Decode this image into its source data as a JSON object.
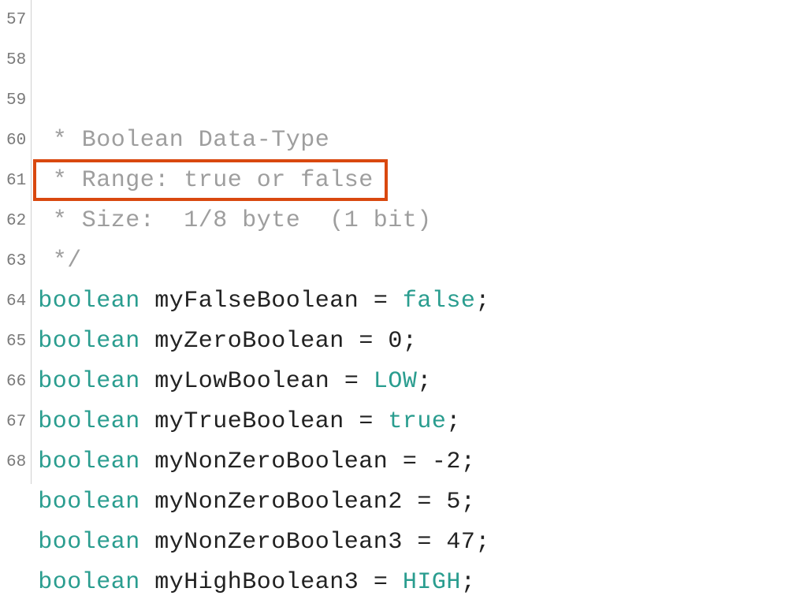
{
  "gutter_start": 57,
  "highlighted_line_index": 1,
  "lines": [
    {
      "tokens": [
        {
          "cls": "tok-comment",
          "text": " * Boolean Data-Type"
        }
      ]
    },
    {
      "tokens": [
        {
          "cls": "tok-comment",
          "text": " * Range: true or false"
        }
      ]
    },
    {
      "tokens": [
        {
          "cls": "tok-comment",
          "text": " * Size:  1/8 byte  (1 bit)"
        }
      ]
    },
    {
      "tokens": [
        {
          "cls": "tok-comment",
          "text": " */"
        }
      ]
    },
    {
      "tokens": [
        {
          "cls": "tok-keyword",
          "text": "boolean"
        },
        {
          "cls": "sp",
          "text": " "
        },
        {
          "cls": "tok-ident",
          "text": "myFalseBoolean"
        },
        {
          "cls": "sp",
          "text": " "
        },
        {
          "cls": "tok-op",
          "text": "="
        },
        {
          "cls": "sp",
          "text": " "
        },
        {
          "cls": "tok-literal",
          "text": "false"
        },
        {
          "cls": "tok-punc",
          "text": ";"
        }
      ]
    },
    {
      "tokens": [
        {
          "cls": "tok-keyword",
          "text": "boolean"
        },
        {
          "cls": "sp",
          "text": " "
        },
        {
          "cls": "tok-ident",
          "text": "myZeroBoolean"
        },
        {
          "cls": "sp",
          "text": " "
        },
        {
          "cls": "tok-op",
          "text": "="
        },
        {
          "cls": "sp",
          "text": " "
        },
        {
          "cls": "tok-number",
          "text": "0"
        },
        {
          "cls": "tok-punc",
          "text": ";"
        }
      ]
    },
    {
      "tokens": [
        {
          "cls": "tok-keyword",
          "text": "boolean"
        },
        {
          "cls": "sp",
          "text": " "
        },
        {
          "cls": "tok-ident",
          "text": "myLowBoolean"
        },
        {
          "cls": "sp",
          "text": " "
        },
        {
          "cls": "tok-op",
          "text": "="
        },
        {
          "cls": "sp",
          "text": " "
        },
        {
          "cls": "tok-const",
          "text": "LOW"
        },
        {
          "cls": "tok-punc",
          "text": ";"
        }
      ]
    },
    {
      "tokens": [
        {
          "cls": "tok-keyword",
          "text": "boolean"
        },
        {
          "cls": "sp",
          "text": " "
        },
        {
          "cls": "tok-ident",
          "text": "myTrueBoolean"
        },
        {
          "cls": "sp",
          "text": " "
        },
        {
          "cls": "tok-op",
          "text": "="
        },
        {
          "cls": "sp",
          "text": " "
        },
        {
          "cls": "tok-literal",
          "text": "true"
        },
        {
          "cls": "tok-punc",
          "text": ";"
        }
      ]
    },
    {
      "tokens": [
        {
          "cls": "tok-keyword",
          "text": "boolean"
        },
        {
          "cls": "sp",
          "text": " "
        },
        {
          "cls": "tok-ident",
          "text": "myNonZeroBoolean"
        },
        {
          "cls": "sp",
          "text": " "
        },
        {
          "cls": "tok-op",
          "text": "="
        },
        {
          "cls": "sp",
          "text": " "
        },
        {
          "cls": "tok-op",
          "text": "-"
        },
        {
          "cls": "tok-number",
          "text": "2"
        },
        {
          "cls": "tok-punc",
          "text": ";"
        }
      ]
    },
    {
      "tokens": [
        {
          "cls": "tok-keyword",
          "text": "boolean"
        },
        {
          "cls": "sp",
          "text": " "
        },
        {
          "cls": "tok-ident",
          "text": "myNonZeroBoolean2"
        },
        {
          "cls": "sp",
          "text": " "
        },
        {
          "cls": "tok-op",
          "text": "="
        },
        {
          "cls": "sp",
          "text": " "
        },
        {
          "cls": "tok-number",
          "text": "5"
        },
        {
          "cls": "tok-punc",
          "text": ";"
        }
      ]
    },
    {
      "tokens": [
        {
          "cls": "tok-keyword",
          "text": "boolean"
        },
        {
          "cls": "sp",
          "text": " "
        },
        {
          "cls": "tok-ident",
          "text": "myNonZeroBoolean3"
        },
        {
          "cls": "sp",
          "text": " "
        },
        {
          "cls": "tok-op",
          "text": "="
        },
        {
          "cls": "sp",
          "text": " "
        },
        {
          "cls": "tok-number",
          "text": "47"
        },
        {
          "cls": "tok-punc",
          "text": ";"
        }
      ]
    },
    {
      "tokens": [
        {
          "cls": "tok-keyword",
          "text": "boolean"
        },
        {
          "cls": "sp",
          "text": " "
        },
        {
          "cls": "tok-ident",
          "text": "myHighBoolean3"
        },
        {
          "cls": "sp",
          "text": " "
        },
        {
          "cls": "tok-op",
          "text": "="
        },
        {
          "cls": "sp",
          "text": " "
        },
        {
          "cls": "tok-const",
          "text": "HIGH"
        },
        {
          "cls": "tok-punc",
          "text": ";"
        }
      ]
    }
  ]
}
